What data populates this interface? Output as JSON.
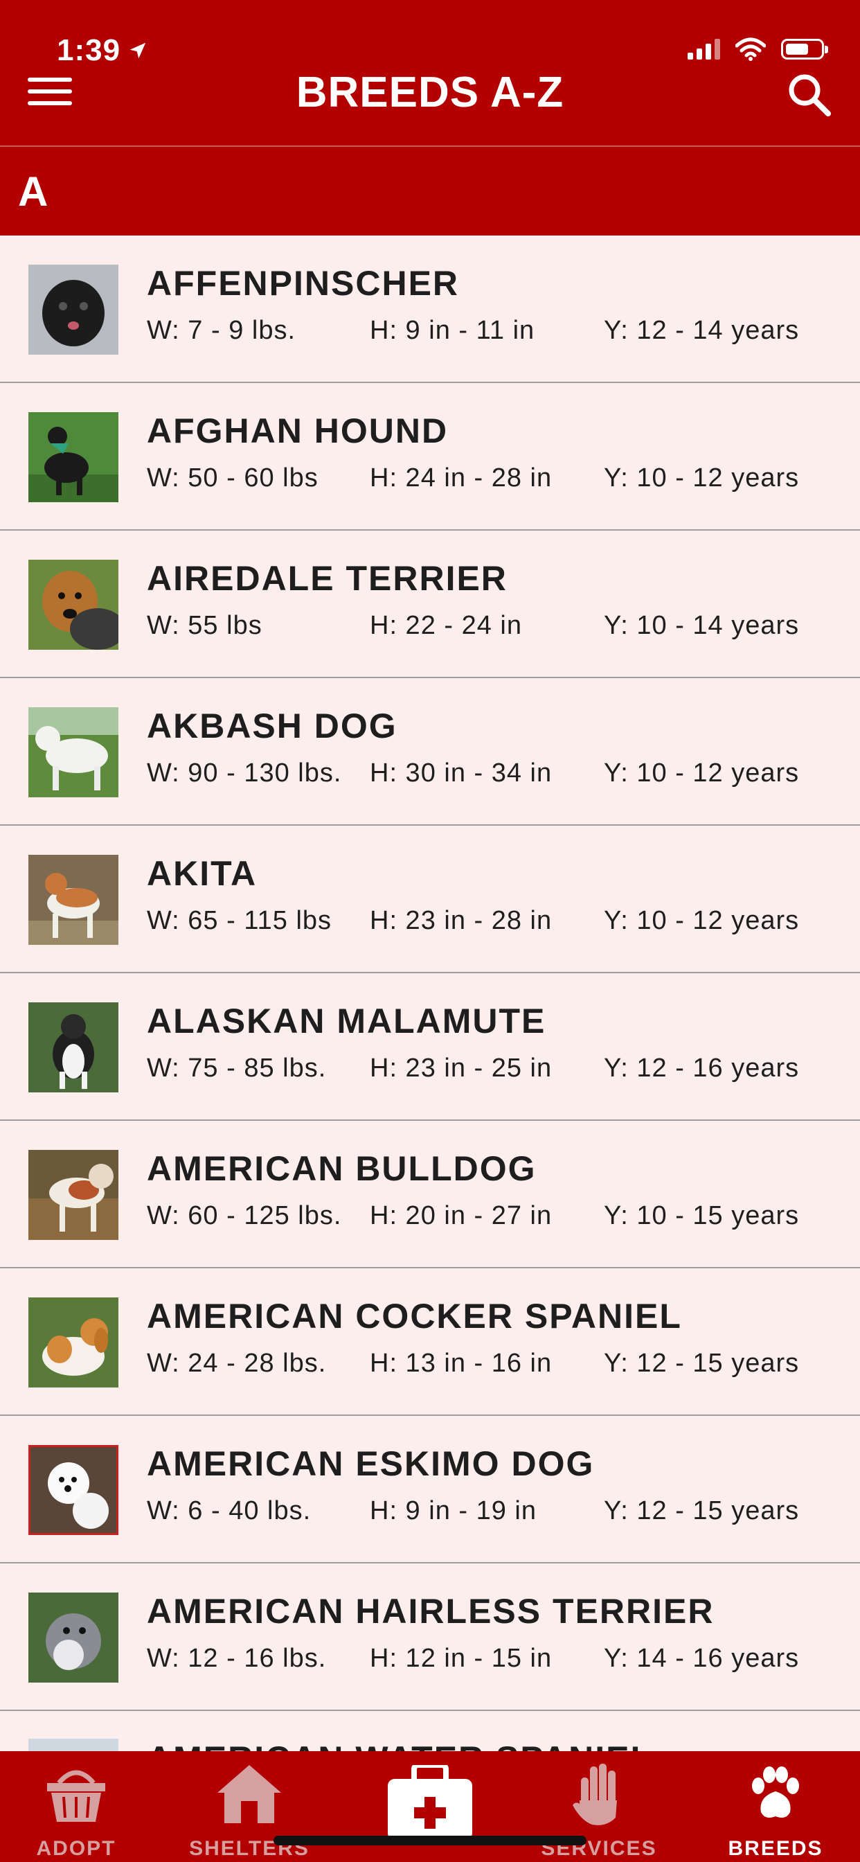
{
  "status_bar": {
    "time": "1:39"
  },
  "header": {
    "title": "BREEDS A-Z"
  },
  "section": {
    "letter": "A"
  },
  "breeds": [
    {
      "name": "AFFENPINSCHER",
      "weight": "W: 7 - 9 lbs.",
      "height": "H: 9 in - 11 in",
      "years": "Y: 12 - 14 years"
    },
    {
      "name": "AFGHAN HOUND",
      "weight": "W: 50 - 60 lbs",
      "height": "H: 24 in - 28 in",
      "years": "Y: 10 - 12 years"
    },
    {
      "name": "AIREDALE TERRIER",
      "weight": "W: 55 lbs",
      "height": "H: 22 - 24 in",
      "years": "Y: 10 - 14 years"
    },
    {
      "name": "AKBASH DOG",
      "weight": "W: 90 - 130 lbs.",
      "height": "H: 30 in - 34 in",
      "years": "Y: 10 - 12 years"
    },
    {
      "name": "AKITA",
      "weight": "W: 65 - 115 lbs",
      "height": "H: 23 in - 28 in",
      "years": "Y: 10 - 12 years"
    },
    {
      "name": "ALASKAN MALAMUTE",
      "weight": "W: 75 - 85 lbs.",
      "height": "H: 23 in - 25 in",
      "years": "Y: 12 - 16 years"
    },
    {
      "name": "AMERICAN BULLDOG",
      "weight": "W: 60 - 125 lbs.",
      "height": "H: 20 in - 27 in",
      "years": "Y: 10 - 15 years"
    },
    {
      "name": "AMERICAN COCKER SPANIEL",
      "weight": "W: 24 - 28 lbs.",
      "height": "H: 13 in - 16 in",
      "years": "Y: 12 - 15 years"
    },
    {
      "name": "AMERICAN ESKIMO DOG",
      "weight": "W: 6 - 40 lbs.",
      "height": "H: 9 in - 19 in",
      "years": "Y: 12 - 15 years"
    },
    {
      "name": "AMERICAN HAIRLESS TERRIER",
      "weight": "W: 12 - 16 lbs.",
      "height": "H: 12 in - 15 in",
      "years": "Y: 14 - 16 years"
    }
  ],
  "partial_breed": {
    "name": "AMERICAN WATER SPANIEL"
  },
  "tabs": [
    {
      "label": "ADOPT",
      "icon": "basket-icon"
    },
    {
      "label": "SHELTERS",
      "icon": "house-icon"
    },
    {
      "label": "",
      "icon": "first-aid-kit-icon"
    },
    {
      "label": "SERVICES",
      "icon": "hand-icon"
    },
    {
      "label": "BREEDS",
      "icon": "paw-icon",
      "active": true
    }
  ],
  "colors": {
    "brand_red": "#b30000",
    "list_bg": "#fdeeee",
    "tab_inactive": "#d6a0a0"
  }
}
